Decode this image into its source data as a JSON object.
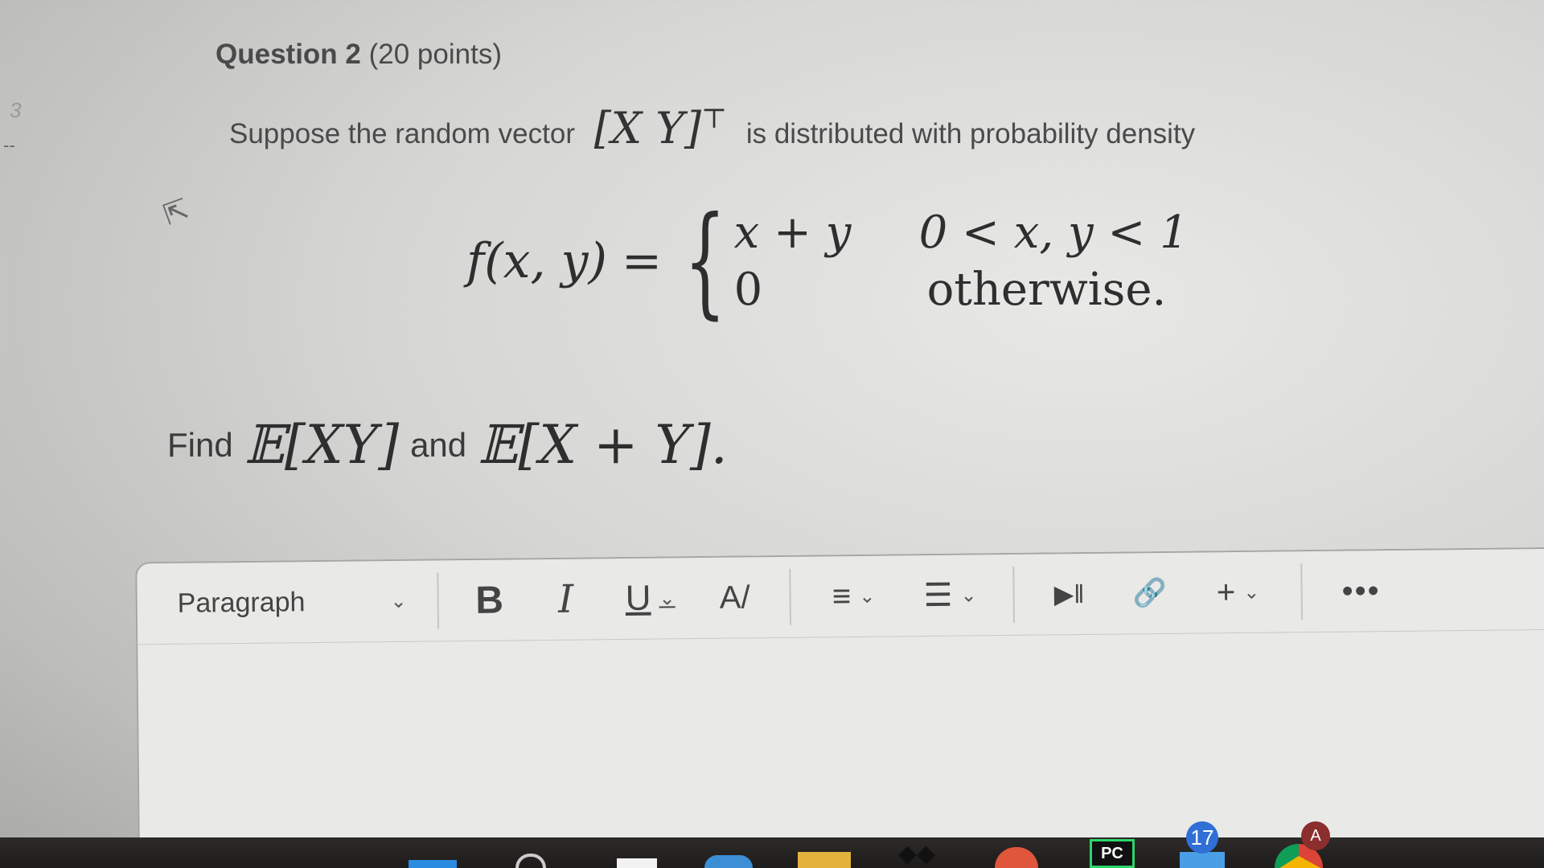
{
  "side_marker": {
    "number": "3",
    "dash": "--"
  },
  "question": {
    "title": "Question 2",
    "points": "(20 points)",
    "intro_before": "Suppose the random vector",
    "vector": "[X Y]",
    "transpose": "⊤",
    "intro_after": "is distributed with probability density"
  },
  "formula": {
    "lhs": "f(x, y)",
    "eq": "=",
    "brace": "{",
    "case1_expr": "x + y",
    "case1_cond": "0 < x, y < 1",
    "case2_expr": "0",
    "case2_cond": "otherwise."
  },
  "find": {
    "prefix": "Find",
    "expr1": "𝔼[XY]",
    "conj": "and",
    "expr2": "𝔼[X + Y].",
    "cursor_icon": "pointer-cursor-icon"
  },
  "toolbar": {
    "paragraph_label": "Paragraph",
    "chevron": "⌄",
    "bold": "B",
    "italic": "I",
    "underline": "U",
    "text_color": "A/",
    "align": "≡",
    "list": "☰",
    "media": "▶‖",
    "link": "🔗",
    "insert": "+",
    "more": "•••"
  },
  "taskbar": {
    "app_pc_label": "PC",
    "notification_count": "17",
    "profile_letter": "A"
  },
  "colors": {
    "background": "#dcdcda",
    "text": "#3a3a3a",
    "taskbar": "#252322",
    "badge": "#2f6fd6"
  }
}
